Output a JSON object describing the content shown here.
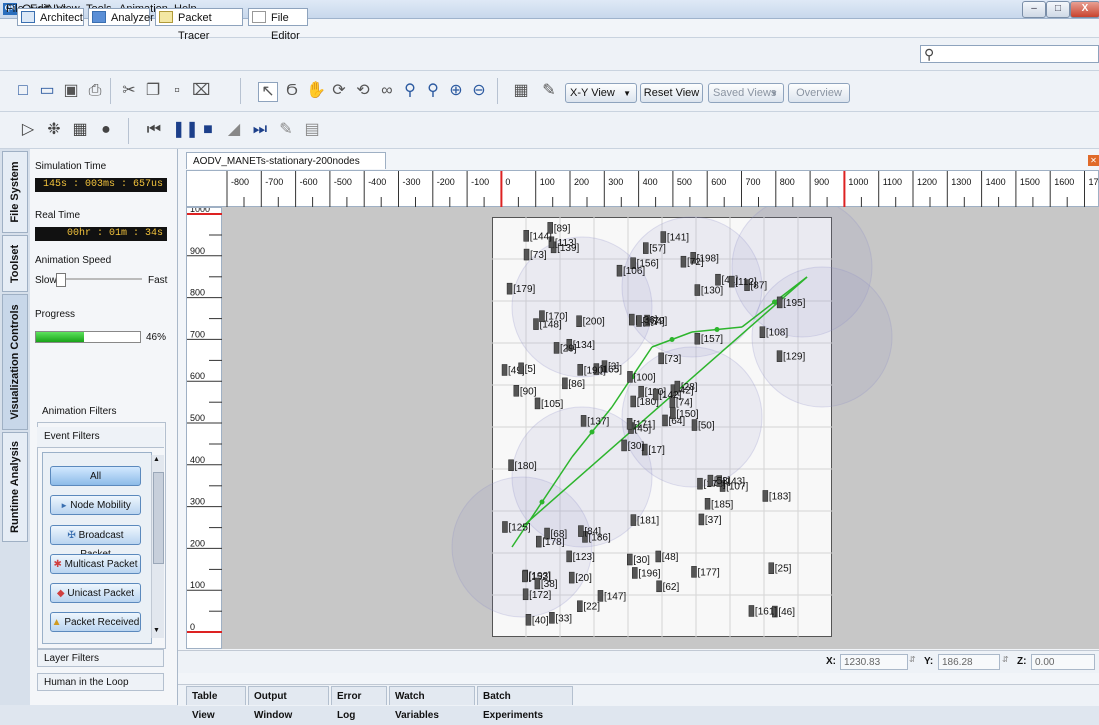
{
  "window": {
    "logo": "QN",
    "title": "QualNet",
    "minimize": "–",
    "maximize": "□",
    "close": "X"
  },
  "menu": [
    "File",
    "Edit",
    "View",
    "Tools",
    "Animation",
    "Help"
  ],
  "perspectives": {
    "architect": "Architect",
    "analyzer": "Analyzer",
    "packet_tracer": "Packet Tracer",
    "file_editor": "File Editor"
  },
  "toolbar": {
    "view_select": "X-Y View",
    "reset_view": "Reset View",
    "saved_views": "Saved Views",
    "overview": "Overview"
  },
  "vertical_tabs": {
    "file_system": "File System",
    "toolset": "Toolset",
    "visualization_controls": "Visualization Controls",
    "runtime_analysis": "Runtime Analysis"
  },
  "left_panel": {
    "simulation_time_label": "Simulation Time",
    "simulation_time": "145s : 003ms : 657us",
    "real_time_label": "Real Time",
    "real_time": "00hr : 01m : 34s",
    "animation_speed_label": "Animation Speed",
    "slow": "Slow",
    "fast": "Fast",
    "progress_label": "Progress",
    "progress_pct": 46,
    "progress_text": "46%",
    "animation_filters": "Animation Filters",
    "event_filters": "Event Filters",
    "filters": [
      "All",
      "Node Mobility",
      "Broadcast Packet",
      "Multicast Packet",
      "Unicast Packet",
      "Packet Received"
    ],
    "layer_filters": "Layer Filters",
    "human_in_loop": "Human in the Loop"
  },
  "scenario": {
    "tab": "AODV_MANETs-stationary-200nodes",
    "x_ticks": [
      "-800",
      "-700",
      "-600",
      "-500",
      "-400",
      "-300",
      "-200",
      "-100",
      "0",
      "100",
      "200",
      "300",
      "400",
      "500",
      "600",
      "700",
      "800",
      "900",
      "1000",
      "1100",
      "1200",
      "1300",
      "1400",
      "1500",
      "1600",
      "1700"
    ],
    "y_ticks": [
      "1000",
      "900",
      "800",
      "700",
      "600",
      "500",
      "400",
      "300",
      "200",
      "100",
      "0"
    ],
    "node_labels": [
      "[17]",
      "[148]",
      "[45]",
      "[193]",
      "[42]",
      "[186]",
      "[198]",
      "[79]",
      "[130]",
      "[64]",
      "[139]",
      "[46]",
      "[105]",
      "[195]",
      "[30]",
      "[157]",
      "[33]",
      "[136]",
      "[73]",
      "[68]",
      "[3]",
      "[172]",
      "[20]",
      "[164]",
      "[28]",
      "[107]",
      "[170]",
      "[156]",
      "[90]",
      "[174]",
      "[129]",
      "[171]",
      "[30]",
      "[180]",
      "[200]",
      "[41]",
      "[84]",
      "[161]",
      "[25]",
      "[143]",
      "[141]",
      "[165]",
      "[86]",
      "[37]",
      "[22]",
      "[49]",
      "[74]",
      "[40]",
      "[196]",
      "[150]",
      "[178]",
      "[108]",
      "[179]",
      "[185]",
      "[177]",
      "[123]",
      "[113]",
      "[144]",
      "[48]",
      "[87]",
      "[57]",
      "[137]",
      "[5]",
      "[134]",
      "[112]",
      "[89]",
      "[72]",
      "[106]",
      "[110]",
      "[125]",
      "[181]",
      "[147]",
      "[53]",
      "[190]",
      "[152]",
      "[73]",
      "[29]",
      "[180]",
      "[100]",
      "[62]",
      "[142]",
      "[38]",
      "[50]",
      "[183]"
    ]
  },
  "status": {
    "x_label": "X:",
    "x_value": "1230.83",
    "y_label": "Y:",
    "y_value": "186.28",
    "z_label": "Z:",
    "z_value": "0.00"
  },
  "bottom_tabs": [
    "Table View",
    "Output Window",
    "Error Log",
    "Watch Variables",
    "Batch Experiments"
  ]
}
